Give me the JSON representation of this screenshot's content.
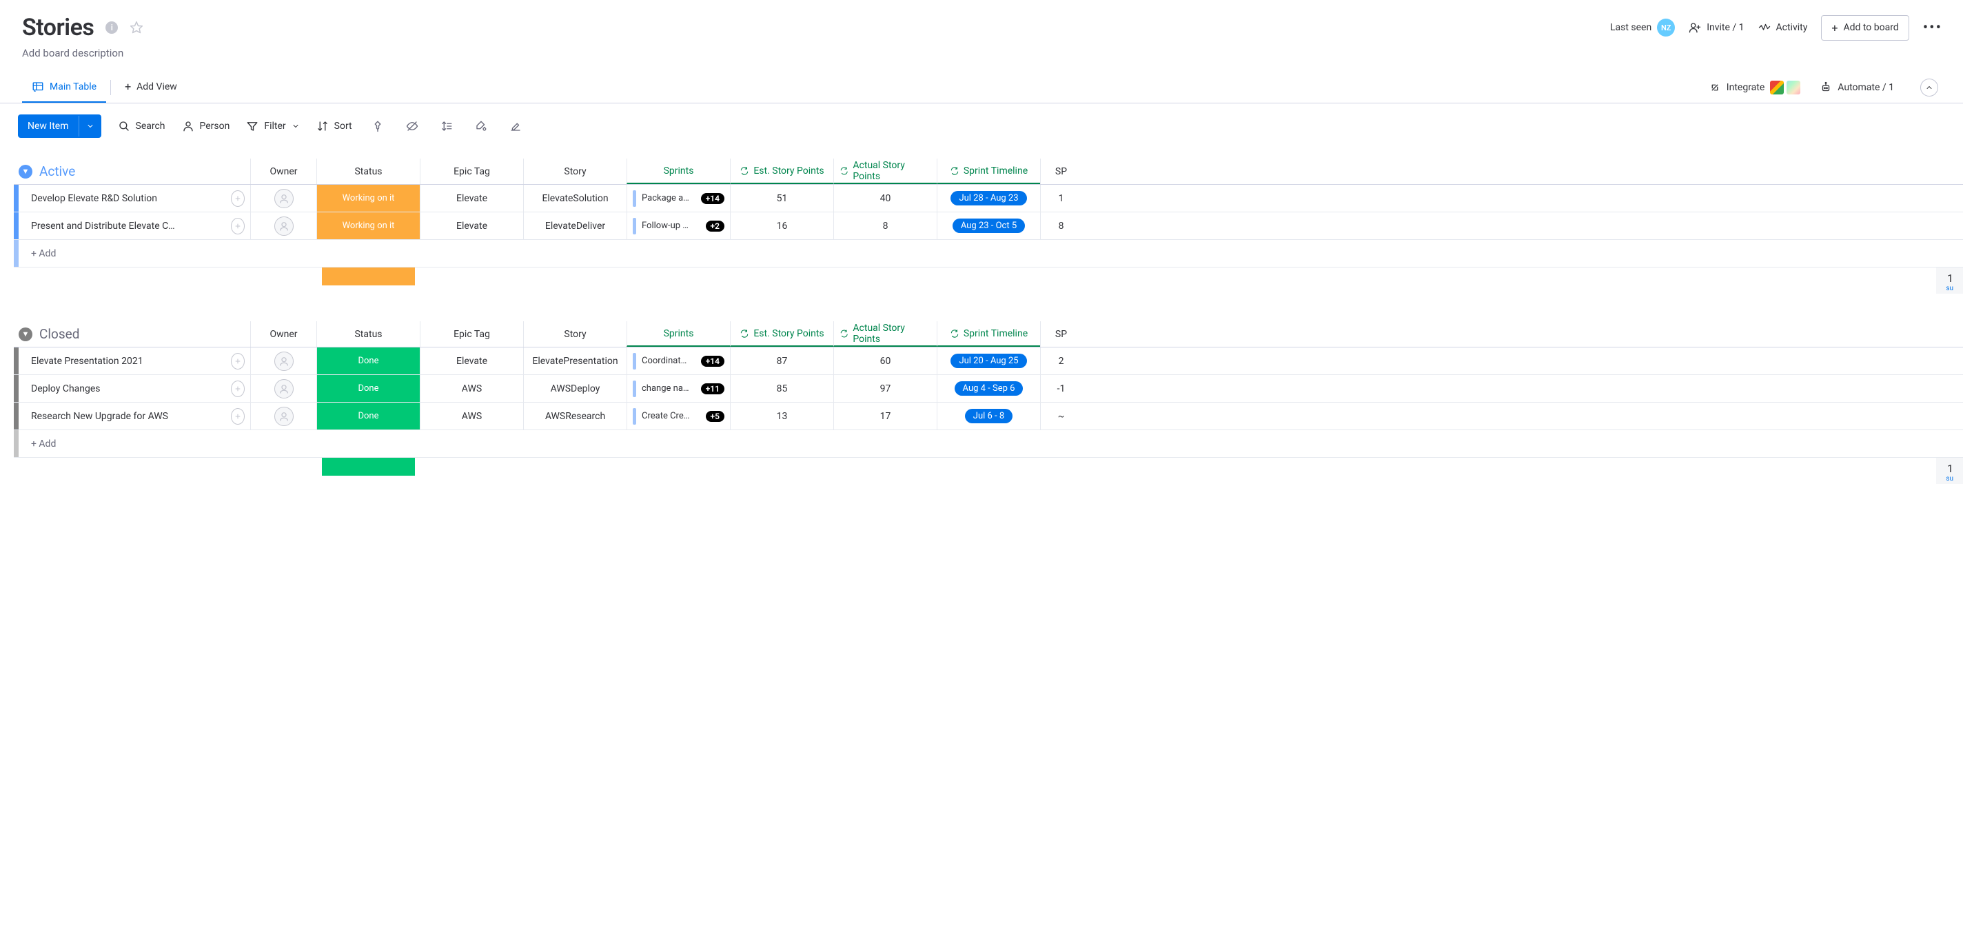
{
  "header": {
    "title": "Stories",
    "last_seen": "Last seen",
    "avatar": "NZ",
    "invite": "Invite / 1",
    "activity": "Activity",
    "add_to_board": "Add to board"
  },
  "description": "Add board description",
  "tabs": {
    "main_table": "Main Table",
    "add_view": "Add View",
    "integrate": "Integrate",
    "automate": "Automate / 1"
  },
  "toolbar": {
    "new_item": "New Item",
    "search": "Search",
    "person": "Person",
    "filter": "Filter",
    "sort": "Sort"
  },
  "columns": {
    "owner": "Owner",
    "status": "Status",
    "epic": "Epic Tag",
    "story": "Story",
    "sprints": "Sprints",
    "esp": "Est. Story Points",
    "asp": "Actual Story Points",
    "timeline": "Sprint Timeline",
    "spx": "SP"
  },
  "add_label": "+ Add",
  "groups": [
    {
      "name": "Active",
      "class": "grp-active",
      "summary_color": "#fdab3d",
      "summary_sp": "1",
      "summary_sub": "su",
      "rows": [
        {
          "name": "Develop Elevate R&D Solution",
          "status": "Working on it",
          "status_class": "st-working",
          "epic": "Elevate",
          "story": "ElevateSolution",
          "sprint": "Package a…",
          "badge": "+14",
          "esp": "51",
          "asp": "40",
          "timeline": "Jul 28 - Aug 23",
          "spx": "1"
        },
        {
          "name": "Present and Distribute Elevate C…",
          "status": "Working on it",
          "status_class": "st-working",
          "epic": "Elevate",
          "story": "ElevateDeliver",
          "sprint": "Follow-up …",
          "badge": "+2",
          "esp": "16",
          "asp": "8",
          "timeline": "Aug 23 - Oct 5",
          "spx": "8"
        }
      ]
    },
    {
      "name": "Closed",
      "class": "grp-closed",
      "summary_color": "#00c875",
      "summary_sp": "1",
      "summary_sub": "su",
      "rows": [
        {
          "name": "Elevate Presentation 2021",
          "status": "Done",
          "status_class": "st-done",
          "epic": "Elevate",
          "story": "ElevatePresentation",
          "sprint": "Coordinat…",
          "badge": "+14",
          "esp": "87",
          "asp": "60",
          "timeline": "Jul 20 - Aug 25",
          "spx": "2"
        },
        {
          "name": "Deploy Changes",
          "status": "Done",
          "status_class": "st-done",
          "epic": "AWS",
          "story": "AWSDeploy",
          "sprint": "change na…",
          "badge": "+11",
          "esp": "85",
          "asp": "97",
          "timeline": "Aug 4 - Sep 6",
          "spx": "-1"
        },
        {
          "name": "Research New Upgrade for AWS",
          "status": "Done",
          "status_class": "st-done",
          "epic": "AWS",
          "story": "AWSResearch",
          "sprint": "Create Cre…",
          "badge": "+5",
          "esp": "13",
          "asp": "17",
          "timeline": "Jul 6 - 8",
          "spx": "~"
        }
      ]
    }
  ]
}
